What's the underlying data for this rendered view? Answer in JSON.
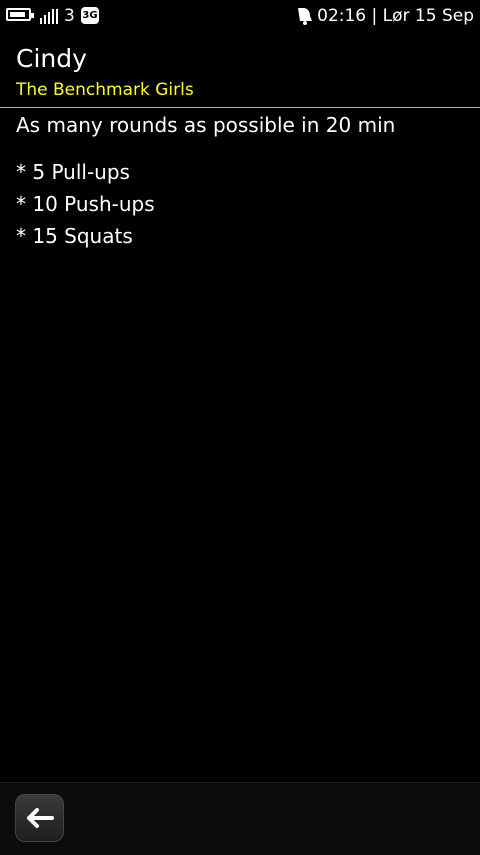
{
  "statusbar": {
    "carrier": "3",
    "network": "3G",
    "datetime": "02:16 | Lør 15 Sep",
    "icons": [
      "battery-icon",
      "signal-icon",
      "network-3g-icon",
      "notification-icon"
    ]
  },
  "header": {
    "title": "Cindy",
    "subtitle": "The Benchmark Girls"
  },
  "workout": {
    "description": "As many rounds as possible in 20 min",
    "exercises": [
      "* 5 Pull-ups",
      "* 10 Push-ups",
      "* 15 Squats"
    ]
  },
  "toolbar": {
    "back_icon": "back-arrow-icon"
  },
  "colors": {
    "background": "#000000",
    "text": "#ffffff",
    "subtitle": "#ffff1a",
    "divider": "#aaaaaa"
  }
}
